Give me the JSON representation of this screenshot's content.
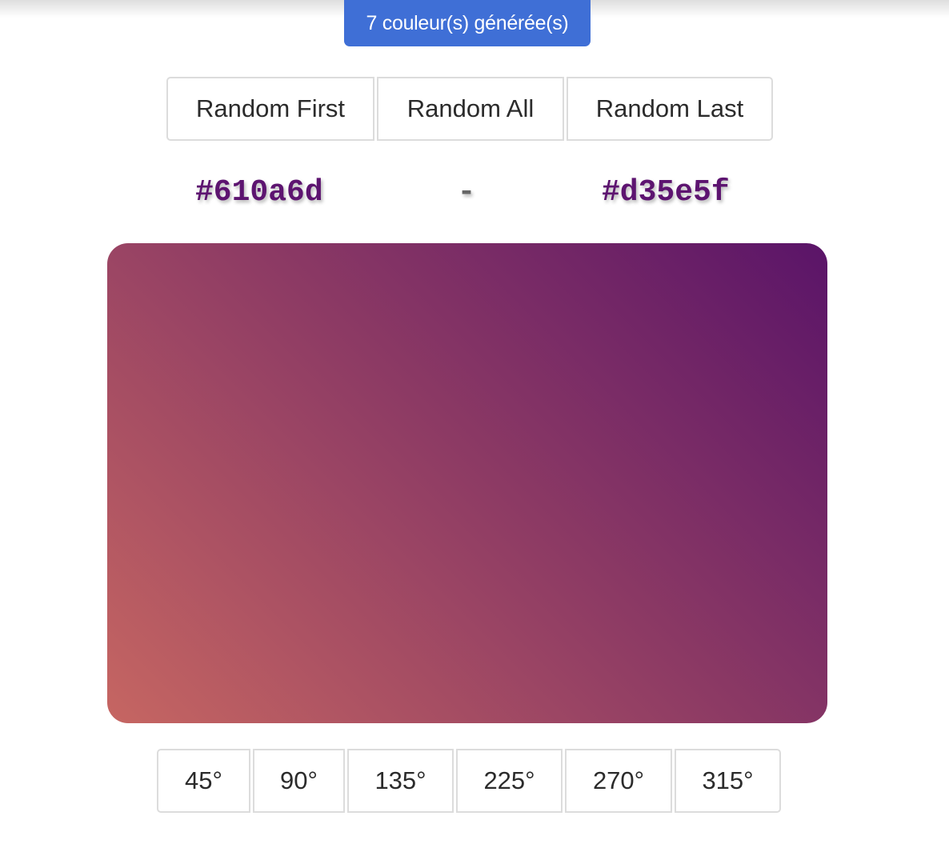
{
  "badge": {
    "text": "7 couleur(s) générée(s)",
    "color": "#3f6fd6"
  },
  "random_buttons": {
    "first": "Random First",
    "all": "Random All",
    "last": "Random Last"
  },
  "colors": {
    "first_hex": "#610a6d",
    "separator": "-",
    "last_hex": "#d35e5f"
  },
  "preview": {
    "angle_deg": 45,
    "colors": [
      "#c66662",
      "#8f3c64",
      "#5a1468"
    ]
  },
  "angles": [
    "45°",
    "90°",
    "135°",
    "225°",
    "270°",
    "315°"
  ]
}
